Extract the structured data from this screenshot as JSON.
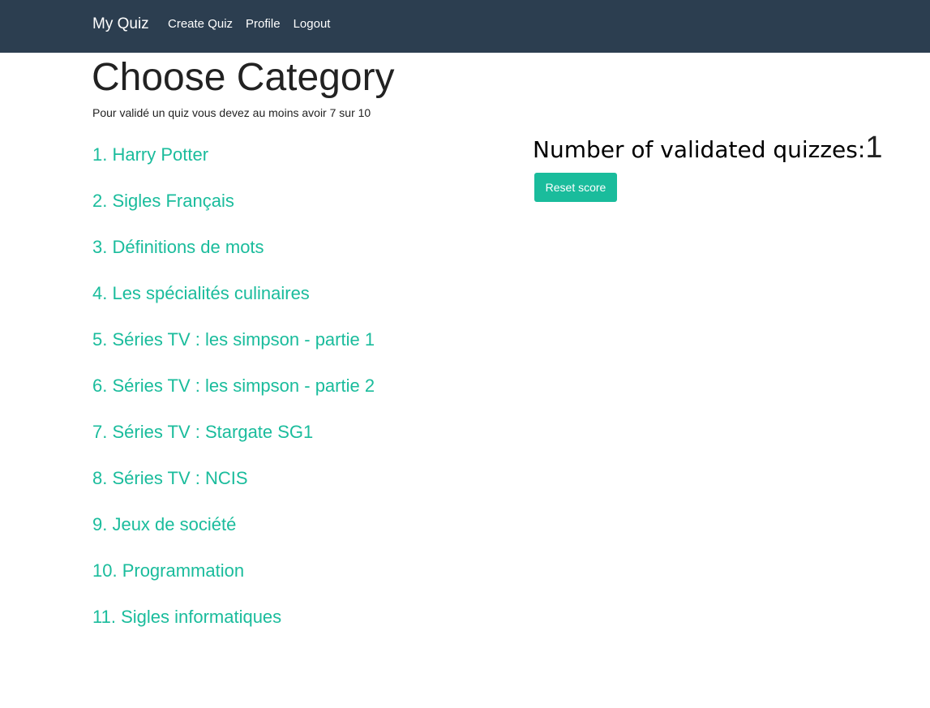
{
  "navbar": {
    "brand": "My Quiz",
    "links": [
      "Create Quiz",
      "Profile",
      "Logout"
    ]
  },
  "main": {
    "title": "Choose Category",
    "rule_text": "Pour validé un quiz vous devez au moins avoir 7 sur 10",
    "categories": [
      "1. Harry Potter",
      "2. Sigles Français",
      "3. Définitions de mots",
      "4. Les spécialités culinaires",
      "5. Séries TV : les simpson - partie 1",
      "6. Séries TV : les simpson - partie 2",
      "7. Séries TV : Stargate SG1",
      "8. Séries TV : NCIS",
      "9. Jeux de société",
      "10. Programmation",
      "11. Sigles informatiques"
    ]
  },
  "score": {
    "label": "Number of validated quizzes:",
    "value": "1",
    "reset_label": "Reset score"
  },
  "colors": {
    "navbar_bg": "#2c3e50",
    "accent": "#1abc9c"
  }
}
